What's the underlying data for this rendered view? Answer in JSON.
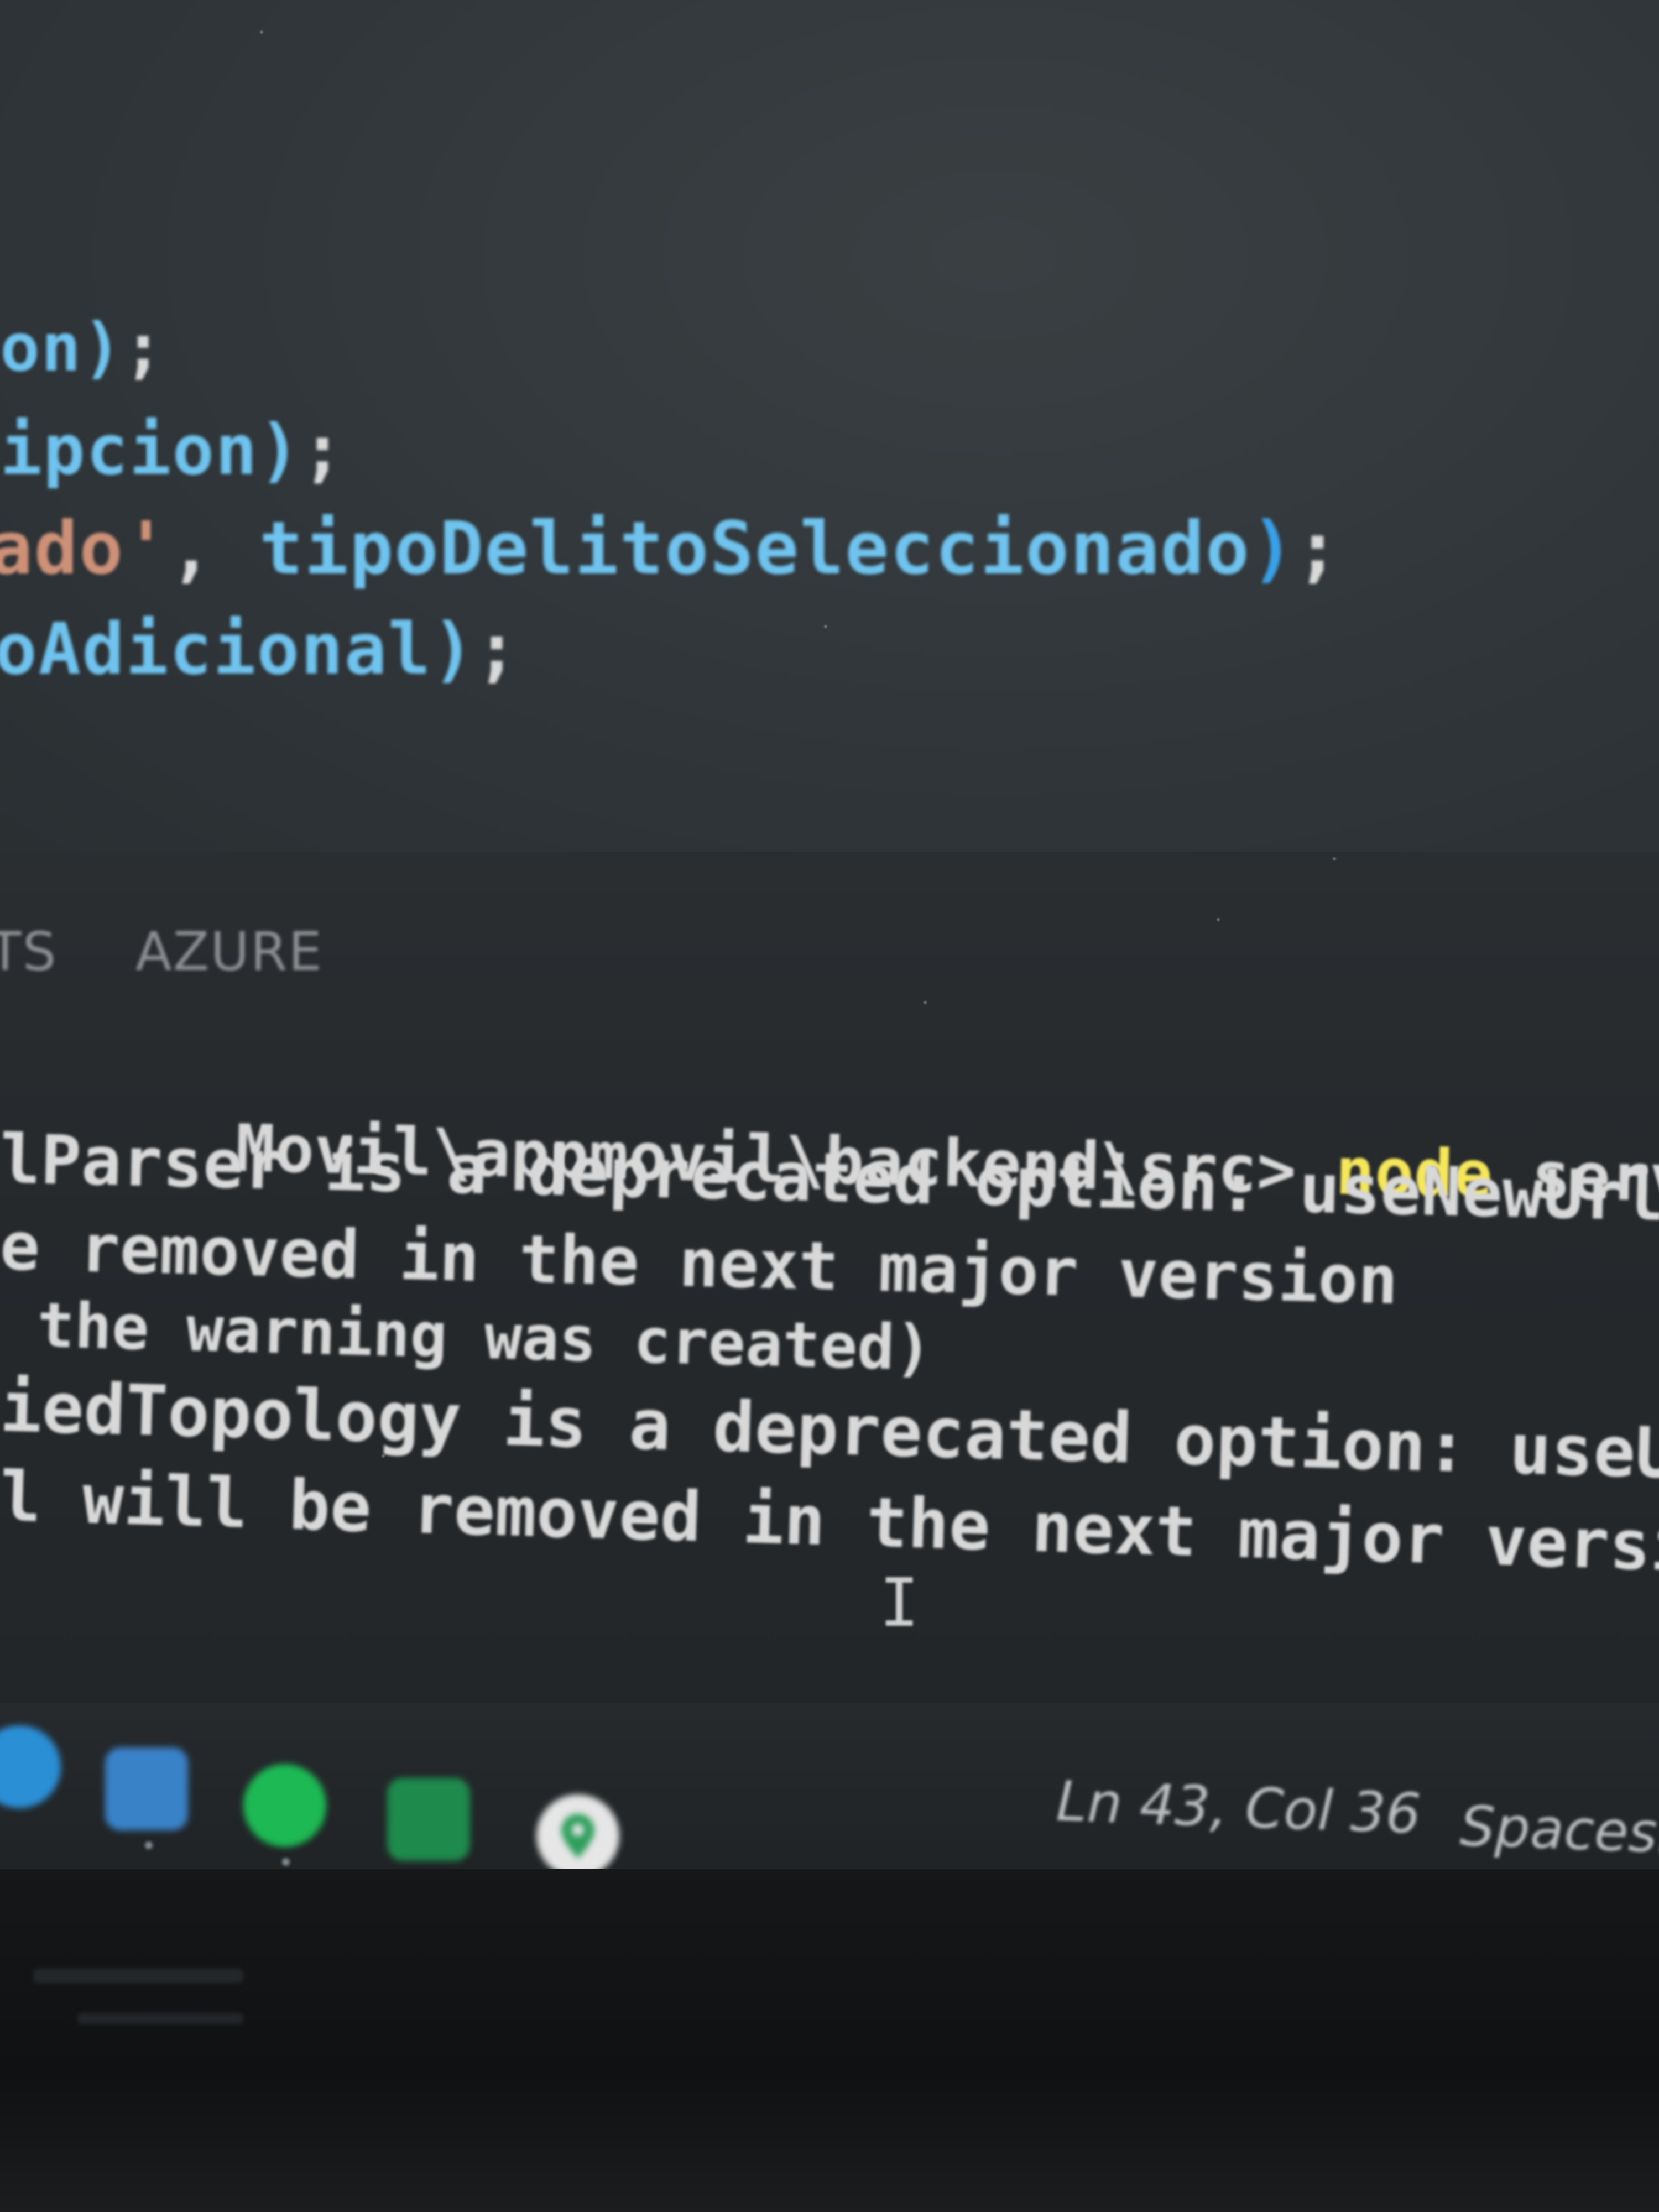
{
  "editor": {
    "code_lines": [
      {
        "segments": [
          {
            "text": "on)",
            "kind": "ident"
          },
          {
            "text": ";",
            "kind": "punct"
          }
        ]
      },
      {
        "segments": [
          {
            "text": "ipcion)",
            "kind": "ident"
          },
          {
            "text": ";",
            "kind": "punct"
          }
        ]
      },
      {
        "segments": [
          {
            "text": "ado'",
            "kind": "string"
          },
          {
            "text": ", ",
            "kind": "punct"
          },
          {
            "text": "tipoDelitoSeleccionado",
            "kind": "ident"
          },
          {
            "text": ")",
            "kind": "paren"
          },
          {
            "text": ";",
            "kind": "punct"
          }
        ]
      },
      {
        "segments": [
          {
            "text": "oAdicional)",
            "kind": "ident"
          },
          {
            "text": ";",
            "kind": "punct"
          }
        ]
      }
    ]
  },
  "panel": {
    "tabs": [
      "TS",
      "AZURE"
    ]
  },
  "terminal": {
    "prompt_path": "Movil\\appmovil\\backend\\src>",
    "command": "node",
    "command_args": "server.js",
    "output_lines": [
      "lParser is a deprecated option: useNewUrlParser",
      "e removed in the next major version",
      " the warning was created)",
      "iedTopology is a deprecated option: useUnifiedTo",
      "l will be removed in the next major version"
    ],
    "cursor_glyph": "I"
  },
  "status_bar": {
    "position": "Ln 43, Col 36",
    "spaces": "Spaces:"
  },
  "taskbar": {
    "icons": [
      {
        "name": "edge-icon",
        "color": "#2b8fd6"
      },
      {
        "name": "vscode-icon",
        "color": "#1f6fb8"
      },
      {
        "name": "spotify-icon",
        "color": "#1db954"
      },
      {
        "name": "excel-icon",
        "color": "#1e8a4c"
      },
      {
        "name": "maps-pin-icon",
        "color": "#e8e8e8"
      }
    ]
  }
}
